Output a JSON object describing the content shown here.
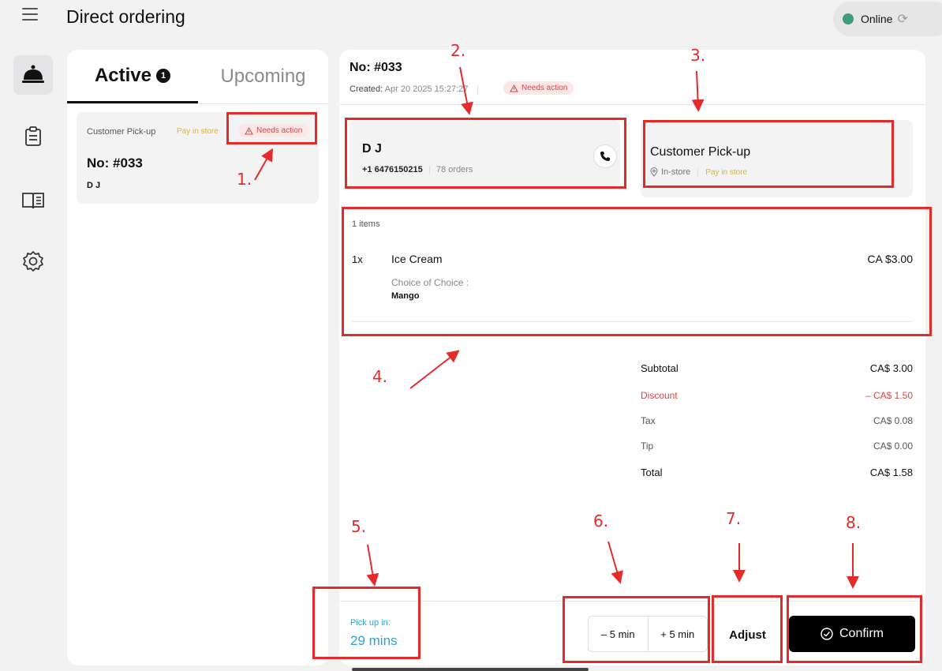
{
  "header": {
    "title": "Direct ordering",
    "status": "Online",
    "status_color": "#3e9c7a"
  },
  "rail": {
    "icons": [
      "service-bell-icon",
      "clipboard-icon",
      "menu-book-icon",
      "settings-gear-icon"
    ]
  },
  "left_panel": {
    "tabs": [
      {
        "label": "Active",
        "badge": "1",
        "selected": true
      },
      {
        "label": "Upcoming",
        "selected": false
      }
    ],
    "orders": [
      {
        "type": "Customer Pick-up",
        "payment": "Pay in store",
        "status": "Needs action",
        "number": "No: #033",
        "customer": "D J"
      }
    ]
  },
  "order": {
    "number": "No: #033",
    "created_label": "Created:",
    "created_value": "Apr 20 2025 15:27:27",
    "status": "Needs action",
    "customer": {
      "name": "D J",
      "phone": "+1 6476150215",
      "orders": "78 orders"
    },
    "fulfillment": {
      "title": "Customer Pick-up",
      "location": "In-store",
      "payment": "Pay in store"
    },
    "items_count": "1 items",
    "items": [
      {
        "qty": "1x",
        "name": "Ice Cream",
        "price": "CA $3.00",
        "option_label": "Choice of Choice :",
        "option_value": "Mango"
      }
    ],
    "summary": {
      "subtotal_label": "Subtotal",
      "subtotal": "CA$ 3.00",
      "discount_label": "Discount",
      "discount": "– CA$ 1.50",
      "tax_label": "Tax",
      "tax": "CA$ 0.08",
      "tip_label": "Tip",
      "tip": "CA$ 0.00",
      "total_label": "Total",
      "total": "CA$ 1.58"
    },
    "pickup_label": "Pick up in:",
    "pickup_value": "29 mins",
    "actions": {
      "minus": "– 5 min",
      "plus": "+ 5 min",
      "adjust": "Adjust",
      "confirm": "Confirm"
    }
  },
  "annotations": [
    "1.",
    "2.",
    "3.",
    "4.",
    "5.",
    "6.",
    "7.",
    "8."
  ],
  "colors": {
    "annotation": "#e52a2a",
    "needs_action": "#d64545",
    "pay_in_store": "#d8b43a",
    "pickup_time": "#2fa3cf"
  }
}
